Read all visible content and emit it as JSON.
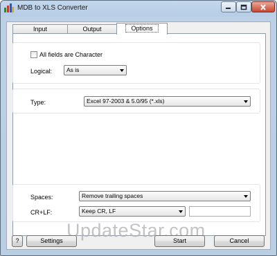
{
  "window": {
    "title": "MDB to XLS Converter"
  },
  "tabs": [
    {
      "label": "Input"
    },
    {
      "label": "Output"
    },
    {
      "label": "Options"
    }
  ],
  "options": {
    "all_fields_character": {
      "label": "All fields are Character",
      "checked": false
    },
    "logical": {
      "label": "Logical:",
      "value": "As is"
    },
    "type": {
      "label": "Type:",
      "value": "Excel 97-2003 & 5.0/95 (*.xls)"
    },
    "spaces": {
      "label": "Spaces:",
      "value": "Remove trailing spaces"
    },
    "crlf": {
      "label": "CR+LF:",
      "value": "Keep CR, LF",
      "text": ""
    }
  },
  "buttons": {
    "help": "?",
    "settings": "Settings",
    "start": "Start",
    "cancel": "Cancel"
  },
  "watermark": "UpdateStar.com",
  "icons": {
    "app": "app-icon",
    "minimize": "minimize-icon",
    "maximize": "maximize-icon",
    "close": "close-icon"
  },
  "colors": {
    "titlebar": "#c3d7ec",
    "close_button": "#c7462e",
    "panel": "#ffffff"
  }
}
